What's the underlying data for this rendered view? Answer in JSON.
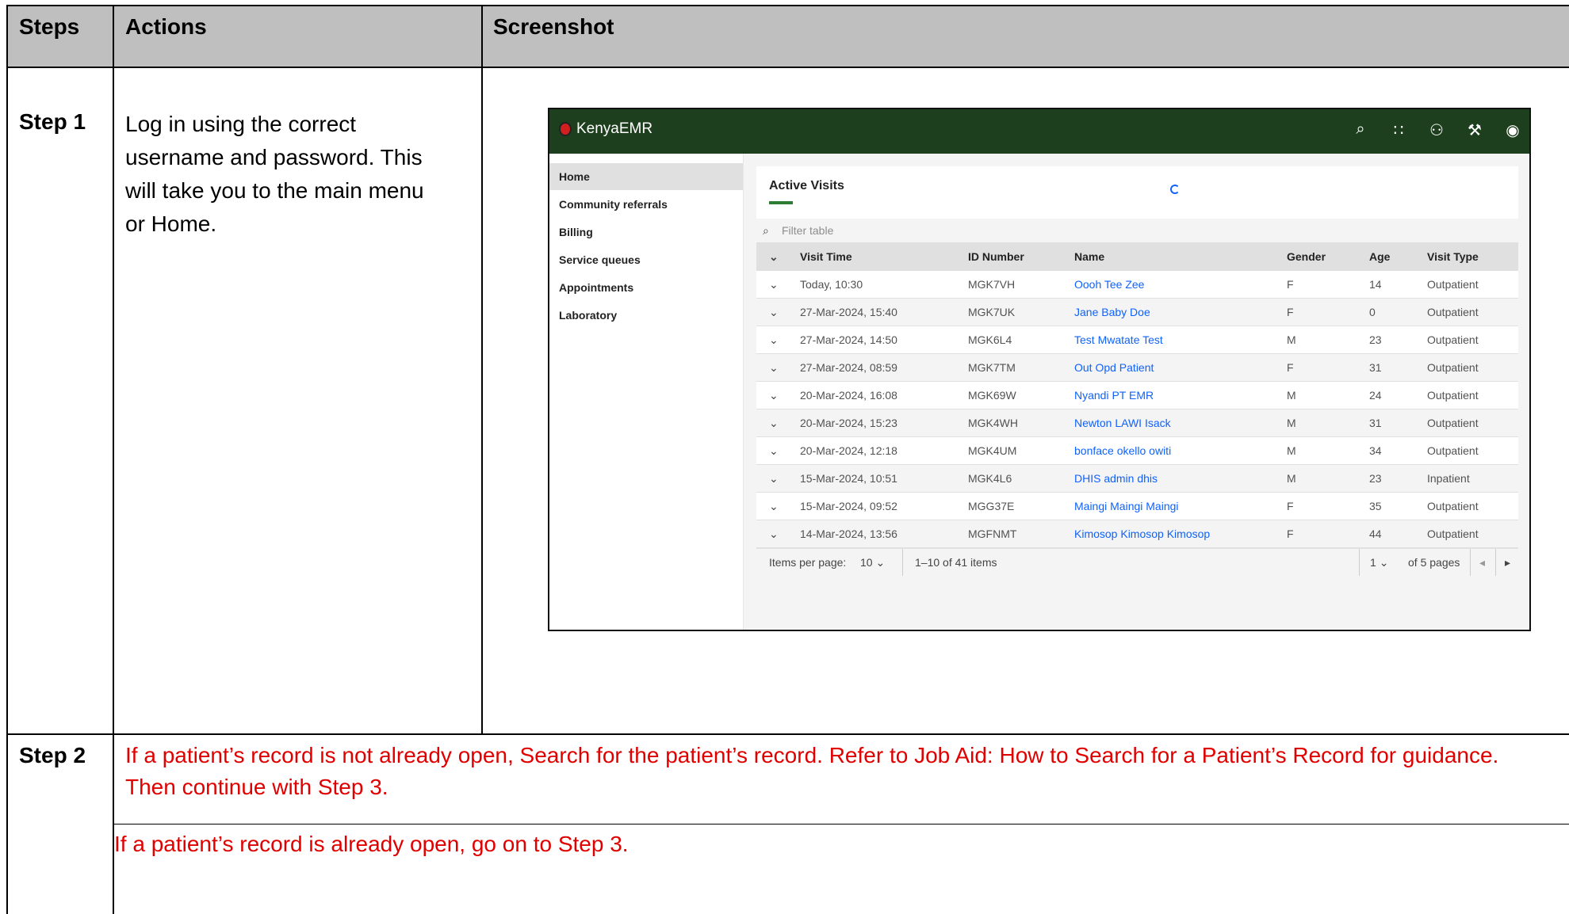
{
  "table": {
    "headers": {
      "steps": "Steps",
      "actions": "Actions",
      "screenshot": "Screenshot"
    },
    "step1": {
      "label": "Step 1",
      "lines": [
        "Log in using the correct",
        "username and password. This",
        "will take you to the main menu",
        "or Home."
      ]
    },
    "step2": {
      "label": "Step 2",
      "line1": "If a patient’s record is not already open, Search for the patient’s record. Refer to Job Aid: How to Search for a Patient’s Record for guidance.",
      "line2": "Then continue with Step 3.",
      "line3": "If a patient’s record is already open, go on to Step 3."
    }
  },
  "app": {
    "brand": "KenyaEMR",
    "nav": [
      "Home",
      "Community referrals",
      "Billing",
      "Service queues",
      "Appointments",
      "Laboratory"
    ],
    "card_title": "Active Visits",
    "filter_placeholder": "Filter table",
    "columns": [
      "Visit Time",
      "ID Number",
      "Name",
      "Gender",
      "Age",
      "Visit Type"
    ],
    "rows": [
      [
        "Today, 10:30",
        "MGK7VH",
        "Oooh Tee Zee",
        "F",
        "14",
        "Outpatient"
      ],
      [
        "27-Mar-2024, 15:40",
        "MGK7UK",
        "Jane Baby Doe",
        "F",
        "0",
        "Outpatient"
      ],
      [
        "27-Mar-2024, 14:50",
        "MGK6L4",
        "Test Mwatate Test",
        "M",
        "23",
        "Outpatient"
      ],
      [
        "27-Mar-2024, 08:59",
        "MGK7TM",
        "Out Opd Patient",
        "F",
        "31",
        "Outpatient"
      ],
      [
        "20-Mar-2024, 16:08",
        "MGK69W",
        "Nyandi PT EMR",
        "M",
        "24",
        "Outpatient"
      ],
      [
        "20-Mar-2024, 15:23",
        "MGK4WH",
        "Newton LAWI Isack",
        "M",
        "31",
        "Outpatient"
      ],
      [
        "20-Mar-2024, 12:18",
        "MGK4UM",
        "bonface okello owiti",
        "M",
        "34",
        "Outpatient"
      ],
      [
        "15-Mar-2024, 10:51",
        "MGK4L6",
        "DHIS admin dhis",
        "M",
        "23",
        "Inpatient"
      ],
      [
        "15-Mar-2024, 09:52",
        "MGG37E",
        "Maingi Maingi Maingi",
        "F",
        "35",
        "Outpatient"
      ],
      [
        "14-Mar-2024, 13:56",
        "MGFNMT",
        "Kimosop Kimosop Kimosop",
        "F",
        "44",
        "Outpatient"
      ]
    ],
    "pager": {
      "items_per_page_label": "Items per page:",
      "items_per_page_value": "10",
      "range": "1–10 of 41 items",
      "page": "1",
      "of_pages": "of 5 pages"
    }
  }
}
